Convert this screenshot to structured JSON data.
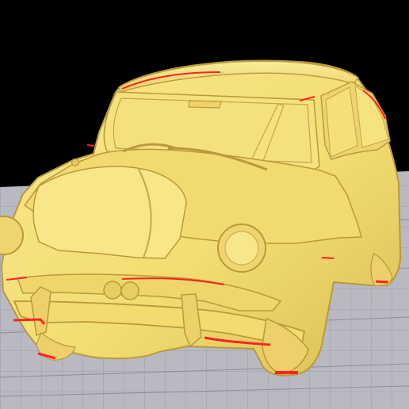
{
  "viewport": {
    "name": "3d-slicer-preview"
  },
  "scene": {
    "background_color": "#000000",
    "bed_color": "#b8b8c2",
    "bed_grid_color": "#8f8f9a",
    "model_color": "#f3de73",
    "model_shadow_color": "#d7bf55",
    "overhang_color": "#ff2323"
  }
}
